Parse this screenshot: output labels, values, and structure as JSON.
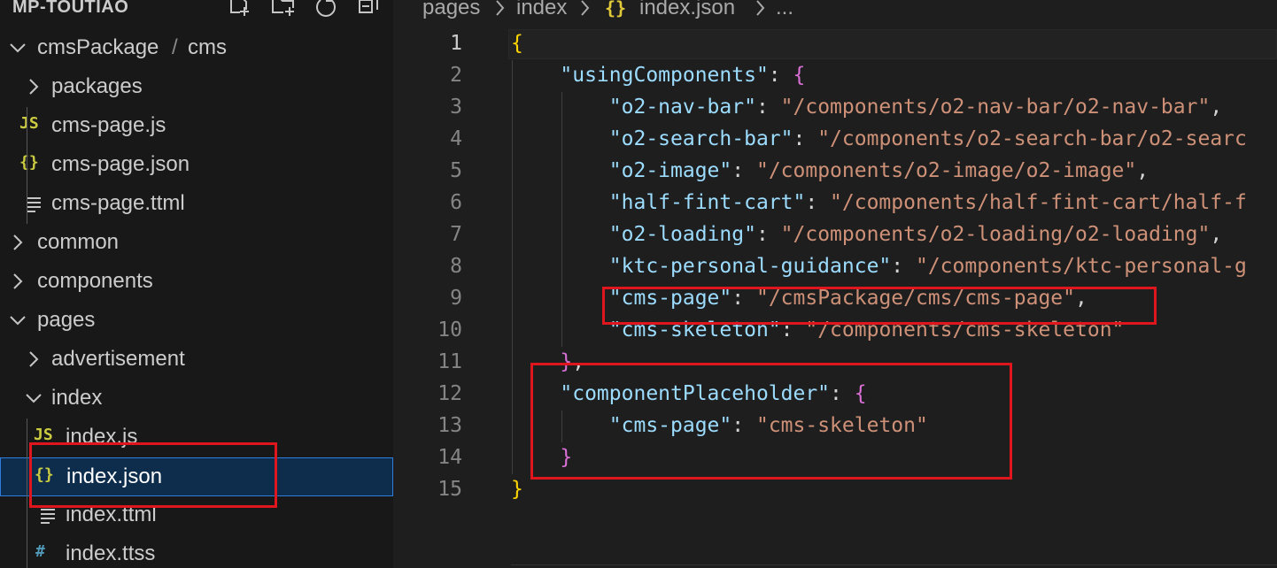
{
  "sidebar": {
    "title": "MP-TOUTIAO",
    "header_icons": [
      "new-file-icon",
      "new-folder-icon",
      "refresh-icon",
      "collapse-all-icon"
    ],
    "items": [
      {
        "label": "cmsPackage",
        "label2": "cms",
        "kind": "folder",
        "expanded": true
      },
      {
        "label": "packages",
        "kind": "folder",
        "expanded": false
      },
      {
        "label": "cms-page.js",
        "kind": "js",
        "icon_text": "JS"
      },
      {
        "label": "cms-page.json",
        "kind": "json",
        "icon_text": "{}"
      },
      {
        "label": "cms-page.ttml",
        "kind": "ttml"
      },
      {
        "label": "common",
        "kind": "folder",
        "expanded": false
      },
      {
        "label": "components",
        "kind": "folder",
        "expanded": false
      },
      {
        "label": "pages",
        "kind": "folder",
        "expanded": true
      },
      {
        "label": "advertisement",
        "kind": "folder",
        "expanded": false
      },
      {
        "label": "index",
        "kind": "folder",
        "expanded": true
      },
      {
        "label": "index.js",
        "kind": "js",
        "icon_text": "JS"
      },
      {
        "label": "index.json",
        "kind": "json",
        "icon_text": "{}",
        "selected": true
      },
      {
        "label": "index.ttml",
        "kind": "ttml"
      },
      {
        "label": "index.ttss",
        "kind": "ttss",
        "icon_text": "#"
      }
    ]
  },
  "breadcrumb": {
    "items": [
      "pages",
      "index",
      "index.json",
      "..."
    ],
    "json_icon_text": "{}"
  },
  "editor": {
    "lines": [
      {
        "n": "1",
        "t": [
          [
            "b1",
            "{"
          ]
        ]
      },
      {
        "n": "2",
        "t": [
          [
            "p",
            "    "
          ],
          [
            "k",
            "\"usingComponents\""
          ],
          [
            "p",
            ": "
          ],
          [
            "b2",
            "{"
          ]
        ]
      },
      {
        "n": "3",
        "t": [
          [
            "p",
            "        "
          ],
          [
            "k",
            "\"o2-nav-bar\""
          ],
          [
            "p",
            ": "
          ],
          [
            "s",
            "\"/components/o2-nav-bar/o2-nav-bar\""
          ],
          [
            "p",
            ","
          ]
        ]
      },
      {
        "n": "4",
        "t": [
          [
            "p",
            "        "
          ],
          [
            "k",
            "\"o2-search-bar\""
          ],
          [
            "p",
            ": "
          ],
          [
            "s",
            "\"/components/o2-search-bar/o2-searc"
          ]
        ]
      },
      {
        "n": "5",
        "t": [
          [
            "p",
            "        "
          ],
          [
            "k",
            "\"o2-image\""
          ],
          [
            "p",
            ": "
          ],
          [
            "s",
            "\"/components/o2-image/o2-image\""
          ],
          [
            "p",
            ","
          ]
        ]
      },
      {
        "n": "6",
        "t": [
          [
            "p",
            "        "
          ],
          [
            "k",
            "\"half-fint-cart\""
          ],
          [
            "p",
            ": "
          ],
          [
            "s",
            "\"/components/half-fint-cart/half-f"
          ]
        ]
      },
      {
        "n": "7",
        "t": [
          [
            "p",
            "        "
          ],
          [
            "k",
            "\"o2-loading\""
          ],
          [
            "p",
            ": "
          ],
          [
            "s",
            "\"/components/o2-loading/o2-loading\""
          ],
          [
            "p",
            ","
          ]
        ]
      },
      {
        "n": "8",
        "t": [
          [
            "p",
            "        "
          ],
          [
            "k",
            "\"ktc-personal-guidance\""
          ],
          [
            "p",
            ": "
          ],
          [
            "s",
            "\"/components/ktc-personal-g"
          ]
        ]
      },
      {
        "n": "9",
        "t": [
          [
            "p",
            "        "
          ],
          [
            "k",
            "\"cms-page\""
          ],
          [
            "p",
            ": "
          ],
          [
            "s",
            "\"/cmsPackage/cms/cms-page\""
          ],
          [
            "p",
            ","
          ]
        ]
      },
      {
        "n": "10",
        "t": [
          [
            "p",
            "        "
          ],
          [
            "k",
            "\"cms-skeleton\""
          ],
          [
            "p",
            ": "
          ],
          [
            "s",
            "\"/components/cms-skeleton\""
          ]
        ]
      },
      {
        "n": "11",
        "t": [
          [
            "p",
            "    "
          ],
          [
            "b2",
            "}"
          ],
          [
            "p",
            ","
          ]
        ]
      },
      {
        "n": "12",
        "t": [
          [
            "p",
            "    "
          ],
          [
            "k",
            "\"componentPlaceholder\""
          ],
          [
            "p",
            ": "
          ],
          [
            "b2",
            "{"
          ]
        ]
      },
      {
        "n": "13",
        "t": [
          [
            "p",
            "        "
          ],
          [
            "k",
            "\"cms-page\""
          ],
          [
            "p",
            ": "
          ],
          [
            "s",
            "\"cms-skeleton\""
          ]
        ]
      },
      {
        "n": "14",
        "t": [
          [
            "p",
            "    "
          ],
          [
            "b2",
            "}"
          ]
        ]
      },
      {
        "n": "15",
        "t": [
          [
            "b1",
            "}"
          ]
        ]
      }
    ]
  },
  "colors": {
    "highlight_box": "#e0161f",
    "selection": "#0e2d4d",
    "key": "#9cdcfe",
    "string": "#ce9178",
    "bracket_level1": "#ffd700",
    "bracket_level2": "#da70d6"
  }
}
